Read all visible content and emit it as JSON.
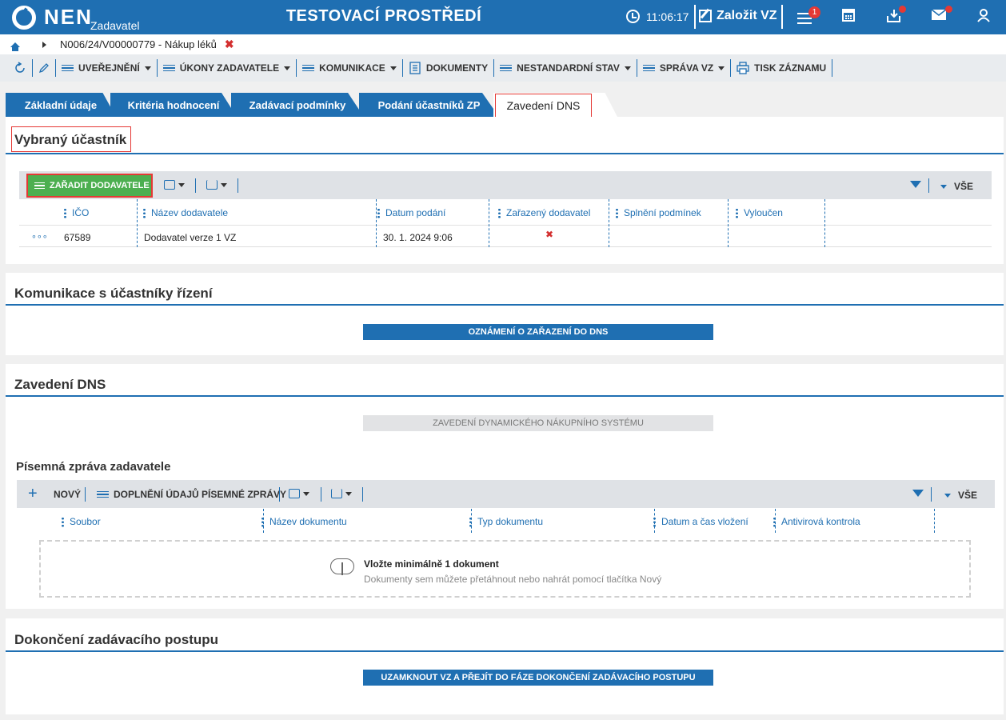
{
  "header": {
    "logo": "NEN",
    "logo_sub": "Zadavatel",
    "env_title": "TESTOVACÍ PROSTŘEDÍ",
    "time": "11:06:17",
    "create_label": "Založit VZ",
    "notif_count": "1"
  },
  "breadcrumb": {
    "text": "N006/24/V00000779 - Nákup léků",
    "close": "✖"
  },
  "toolbar": {
    "items": [
      "UVEŘEJNĚNÍ",
      "ÚKONY ZADAVATELE",
      "KOMUNIKACE",
      "DOKUMENTY",
      "NESTANDARDNÍ STAV",
      "SPRÁVA VZ",
      "TISK ZÁZNAMU"
    ]
  },
  "tabs": [
    "Základní údaje",
    "Kritéria hodnocení",
    "Zadávací podmínky",
    "Podání účastníků ZP",
    "Zavedení DNS"
  ],
  "selected_participant": {
    "title": "Vybraný účastník",
    "add_button": "ZAŘADIT DODAVATELE",
    "all_label": "VŠE",
    "columns": [
      "IČO",
      "Název dodavatele",
      "Datum podání",
      "Zařazený dodavatel",
      "Splnění podmínek",
      "Vyloučen"
    ],
    "rows": [
      {
        "menu": "∘∘∘",
        "ico": "67589",
        "name": "Dodavatel verze 1 VZ",
        "date": "30. 1. 2024 9:06",
        "assigned": "✖",
        "conditions": "",
        "excluded": ""
      }
    ]
  },
  "communication": {
    "title": "Komunikace s účastníky řízení",
    "button": "OZNÁMENÍ O ZAŘAZENÍ DO DNS"
  },
  "dns": {
    "title": "Zavedení DNS",
    "button": "ZAVEDENÍ DYNAMICKÉHO NÁKUPNÍHO SYSTÉMU",
    "report_title": "Písemná zpráva zadavatele",
    "new_label": "NOVÝ",
    "fill_label": "DOPLNĚNÍ ÚDAJŮ PÍSEMNÉ ZPRÁVY",
    "all_label": "VŠE",
    "columns": [
      "Soubor",
      "Název dokumentu",
      "Typ dokumentu",
      "Datum a čas vložení",
      "Antivirová kontrola"
    ],
    "drop_title": "Vložte minimálně 1 dokument",
    "drop_hint": "Dokumenty sem můžete přetáhnout nebo nahrát pomocí tlačítka Nový"
  },
  "finish": {
    "title": "Dokončení zadávacího postupu",
    "button": "UZAMKNOUT VZ A PŘEJÍT DO FÁZE DOKONČENÍ ZADÁVACÍHO POSTUPU"
  }
}
